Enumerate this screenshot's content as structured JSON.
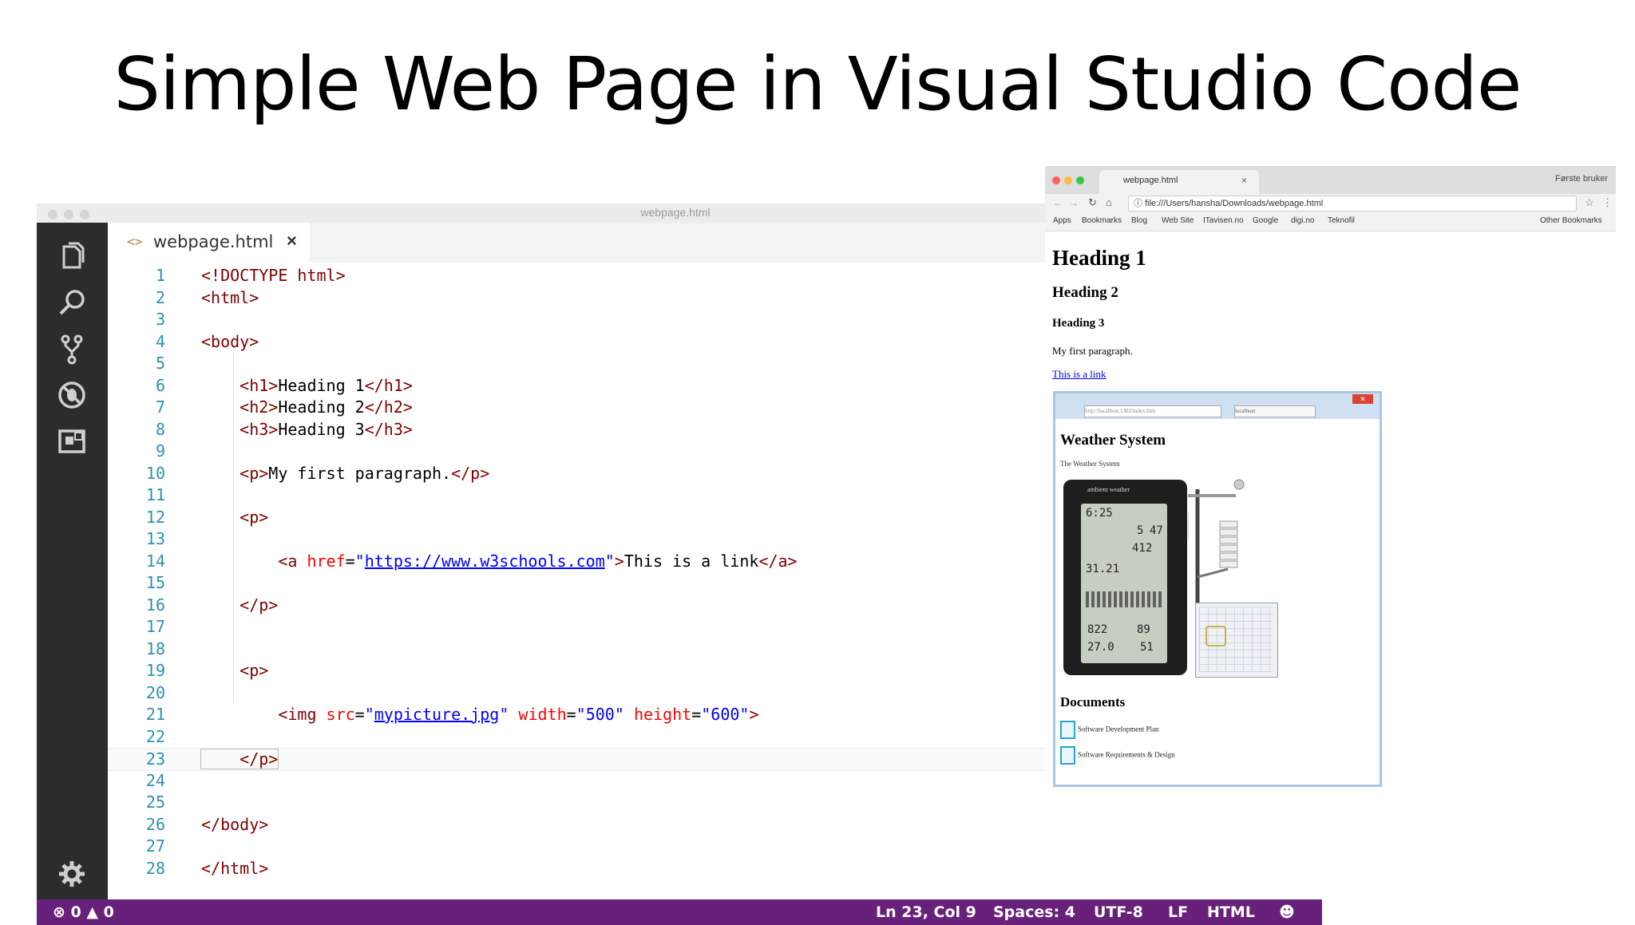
{
  "slide": {
    "title": "Simple Web Page in Visual Studio Code"
  },
  "vscode": {
    "window_title": "webpage.html",
    "tab": {
      "label": "webpage.html",
      "lang_icon": "<>",
      "close": "×"
    },
    "status": {
      "errors": "0",
      "warnings": "0",
      "position": "Ln 23, Col 9",
      "spaces": "Spaces: 4",
      "encoding": "UTF-8",
      "eol": "LF",
      "language": "HTML"
    },
    "lines": [
      {
        "n": "1",
        "segs": [
          {
            "t": "tag",
            "v": "<!DOCTYPE html>"
          }
        ]
      },
      {
        "n": "2",
        "segs": [
          {
            "t": "tag",
            "v": "<html>"
          }
        ]
      },
      {
        "n": "3",
        "segs": []
      },
      {
        "n": "4",
        "segs": [
          {
            "t": "tag",
            "v": "<body>"
          }
        ]
      },
      {
        "n": "5",
        "segs": []
      },
      {
        "n": "6",
        "segs": [
          {
            "t": "tag",
            "v": "    <h1>"
          },
          {
            "t": "txt",
            "v": "Heading 1"
          },
          {
            "t": "tag",
            "v": "</h1>"
          }
        ]
      },
      {
        "n": "7",
        "segs": [
          {
            "t": "tag",
            "v": "    <h2>"
          },
          {
            "t": "txt",
            "v": "Heading 2"
          },
          {
            "t": "tag",
            "v": "</h2>"
          }
        ]
      },
      {
        "n": "8",
        "segs": [
          {
            "t": "tag",
            "v": "    <h3>"
          },
          {
            "t": "txt",
            "v": "Heading 3"
          },
          {
            "t": "tag",
            "v": "</h3>"
          }
        ]
      },
      {
        "n": "9",
        "segs": []
      },
      {
        "n": "10",
        "segs": [
          {
            "t": "tag",
            "v": "    <p>"
          },
          {
            "t": "txt",
            "v": "My first paragraph."
          },
          {
            "t": "tag",
            "v": "</p>"
          }
        ]
      },
      {
        "n": "11",
        "segs": []
      },
      {
        "n": "12",
        "segs": [
          {
            "t": "tag",
            "v": "    <p>"
          }
        ]
      },
      {
        "n": "13",
        "segs": []
      },
      {
        "n": "14",
        "segs": [
          {
            "t": "tag",
            "v": "        <a "
          },
          {
            "t": "attr",
            "v": "href"
          },
          {
            "t": "txt",
            "v": "="
          },
          {
            "t": "val",
            "v": "\""
          },
          {
            "t": "u",
            "v": "https://www.w3schools.com"
          },
          {
            "t": "val",
            "v": "\""
          },
          {
            "t": "tag",
            "v": ">"
          },
          {
            "t": "txt",
            "v": "This is a link"
          },
          {
            "t": "tag",
            "v": "</a>"
          }
        ]
      },
      {
        "n": "15",
        "segs": []
      },
      {
        "n": "16",
        "segs": [
          {
            "t": "tag",
            "v": "    </p>"
          }
        ]
      },
      {
        "n": "17",
        "segs": []
      },
      {
        "n": "18",
        "segs": []
      },
      {
        "n": "19",
        "segs": [
          {
            "t": "tag",
            "v": "    <p>"
          }
        ]
      },
      {
        "n": "20",
        "segs": []
      },
      {
        "n": "21",
        "segs": [
          {
            "t": "tag",
            "v": "        <img "
          },
          {
            "t": "attr",
            "v": "src"
          },
          {
            "t": "txt",
            "v": "="
          },
          {
            "t": "val",
            "v": "\""
          },
          {
            "t": "u",
            "v": "mypicture.jpg"
          },
          {
            "t": "val",
            "v": "\""
          },
          {
            "t": "txt",
            "v": " "
          },
          {
            "t": "attr",
            "v": "width"
          },
          {
            "t": "txt",
            "v": "="
          },
          {
            "t": "val",
            "v": "\"500\""
          },
          {
            "t": "txt",
            "v": " "
          },
          {
            "t": "attr",
            "v": "height"
          },
          {
            "t": "txt",
            "v": "="
          },
          {
            "t": "val",
            "v": "\"600\""
          },
          {
            "t": "tag",
            "v": ">"
          }
        ]
      },
      {
        "n": "22",
        "segs": []
      },
      {
        "n": "23",
        "segs": [
          {
            "t": "tag",
            "v": "    </p>"
          }
        ]
      },
      {
        "n": "24",
        "segs": []
      },
      {
        "n": "25",
        "segs": []
      },
      {
        "n": "26",
        "segs": [
          {
            "t": "tag",
            "v": "</body>"
          }
        ]
      },
      {
        "n": "27",
        "segs": []
      },
      {
        "n": "28",
        "segs": [
          {
            "t": "tag",
            "v": "</html>"
          }
        ]
      }
    ],
    "current_line": "23",
    "activity_icons": [
      "files-icon",
      "search-icon",
      "source-control-icon",
      "debug-icon",
      "extensions-icon",
      "gear-icon"
    ]
  },
  "browser": {
    "tab_title": "webpage.html",
    "tab_close": "×",
    "user": "Første bruker",
    "url": "file:///Users/hansha/Downloads/webpage.html",
    "bookmarks": [
      "Apps",
      "Bookmarks",
      "Blog",
      "Web Site",
      "ITavisen.no",
      "Google",
      "digi.no",
      "Teknofil"
    ],
    "other_bookmarks": "Other Bookmarks",
    "page": {
      "h1": "Heading 1",
      "h2": "Heading 2",
      "h3": "Heading 3",
      "paragraph": "My first paragraph.",
      "link": "This is a link"
    },
    "image": {
      "title": "Weather System",
      "subtitle": "The Weather System",
      "url": "http://localhost:1302/index.htm",
      "tab": "localhost",
      "documents_heading": "Documents",
      "documents": [
        "Software Development Plan",
        "Software Requirements & Design"
      ],
      "station_brand": "ambient weather",
      "readouts": [
        "6:25",
        "5",
        "47",
        "412",
        "31.21",
        "822",
        "89",
        "27.0",
        "51"
      ]
    }
  }
}
